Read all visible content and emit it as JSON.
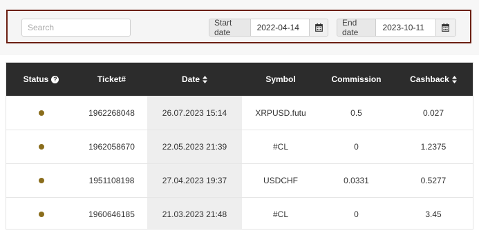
{
  "filters": {
    "search": {
      "placeholder": "Search",
      "value": ""
    },
    "start_date": {
      "label": "Start date",
      "value": "2022-04-14"
    },
    "end_date": {
      "label": "End date",
      "value": "2023-10-11"
    }
  },
  "table": {
    "headers": {
      "status": "Status",
      "ticket": "Ticket#",
      "date": "Date",
      "symbol": "Symbol",
      "commission": "Commission",
      "cashback": "Cashback"
    },
    "rows": [
      {
        "ticket": "1962268048",
        "date": "26.07.2023 15:14",
        "symbol": "XRPUSD.futu",
        "commission": "0.5",
        "cashback": "0.027"
      },
      {
        "ticket": "1962058670",
        "date": "22.05.2023 21:39",
        "symbol": "#CL",
        "commission": "0",
        "cashback": "1.2375"
      },
      {
        "ticket": "1951108198",
        "date": "27.04.2023 19:37",
        "symbol": "USDCHF",
        "commission": "0.0331",
        "cashback": "0.5277"
      },
      {
        "ticket": "1960646185",
        "date": "21.03.2023 21:48",
        "symbol": "#CL",
        "commission": "0",
        "cashback": "3.45"
      }
    ]
  },
  "colors": {
    "status_dot": "#8a6d1c",
    "header_bg": "#2c2c2c",
    "filter_border": "#6b1f12"
  },
  "icons": {
    "search": "search-icon",
    "calendar": "calendar-icon",
    "help": "help-icon",
    "sort": "sort-icon"
  }
}
